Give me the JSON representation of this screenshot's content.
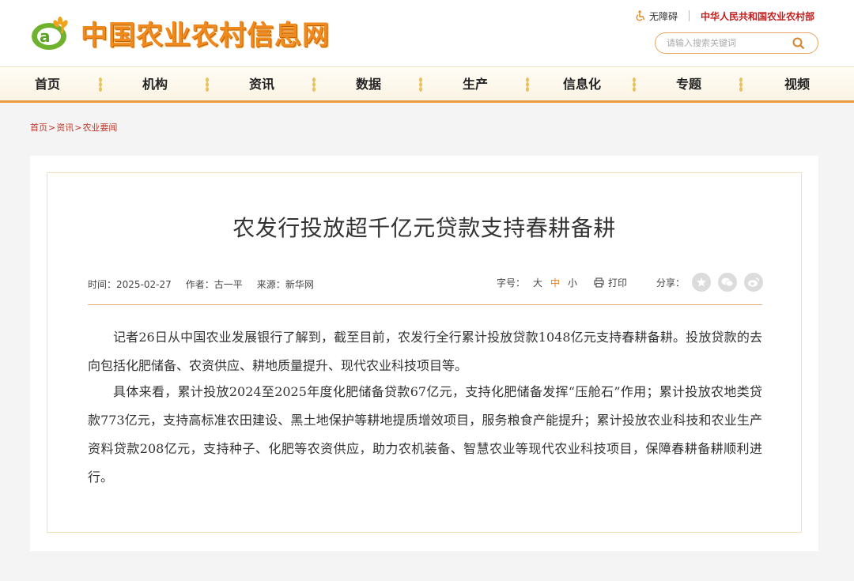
{
  "site": {
    "logo_text": "中国农业农村信息网",
    "accessibility_label": "无障碍",
    "ministry_link": "中华人民共和国农业农村部"
  },
  "search": {
    "placeholder": "请输入搜索关键词"
  },
  "nav": {
    "items": [
      "首页",
      "机构",
      "资讯",
      "数据",
      "生产",
      "信息化",
      "专题",
      "视频"
    ]
  },
  "breadcrumb": {
    "items": [
      "首页",
      "资讯",
      "农业要闻"
    ],
    "separator": ">"
  },
  "article": {
    "title": "农发行投放超千亿元贷款支持春耕备耕",
    "time_label": "时间：",
    "time": "2025-02-27",
    "author_label": "作者：",
    "author": "古一平",
    "source_label": "来源：",
    "source": "新华网",
    "fontsize_label": "字号：",
    "fontsize_large": "大",
    "fontsize_medium": "中",
    "fontsize_small": "小",
    "print_label": "打印",
    "share_label": "分享：",
    "paragraphs": [
      "记者26日从中国农业发展银行了解到，截至目前，农发行全行累计投放贷款1048亿元支持春耕备耕。投放贷款的去向包括化肥储备、农资供应、耕地质量提升、现代农业科技项目等。",
      "具体来看，累计投放2024至2025年度化肥储备贷款67亿元，支持化肥储备发挥“压舱石”作用；累计投放农地类贷款773亿元，支持高标准农田建设、黑土地保护等耕地提质增效项目，服务粮食产能提升；累计投放农业科技和农业生产资料贷款208亿元，支持种子、化肥等农资供应，助力农机装备、智慧农业等现代农业科技项目，保障春耕备耕顺利进行。"
    ]
  },
  "colors": {
    "accent": "#eb9a3f",
    "brand_orange": "#f08a1c",
    "ministry_red": "#c51d1d",
    "breadcrumb_red": "#c0392b",
    "active_fontsize": "#e87e1a"
  },
  "icons": {
    "accessibility": "wheelchair-icon",
    "search": "search-icon",
    "nav_separator": "wheat-icon",
    "print": "printer-icon",
    "share": [
      "qq-icon",
      "wechat-icon",
      "weibo-icon"
    ]
  }
}
